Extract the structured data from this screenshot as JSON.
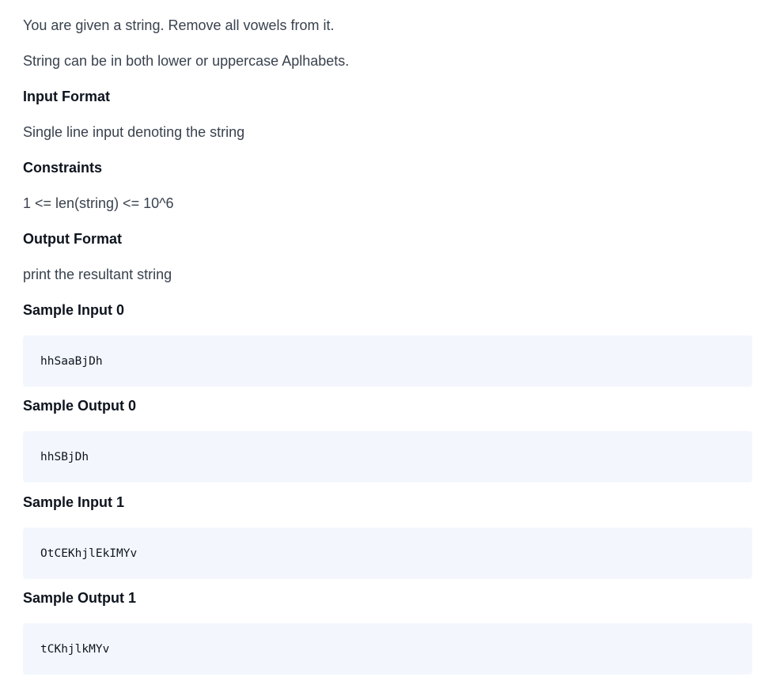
{
  "problem": {
    "statement_1": "You are given a string. Remove all vowels from it.",
    "statement_2": "String can be in both lower or uppercase Aplhabets.",
    "input_format_heading": "Input Format",
    "input_format_text": "Single line input denoting the string",
    "constraints_heading": "Constraints",
    "constraints_text": "1 <= len(string) <= 10^6",
    "output_format_heading": "Output Format",
    "output_format_text": "print the resultant string",
    "samples": [
      {
        "heading": "Sample Input 0",
        "code": "hhSaaBjDh"
      },
      {
        "heading": "Sample Output 0",
        "code": "hhSBjDh"
      },
      {
        "heading": "Sample Input 1",
        "code": "OtCEKhjlEkIMYv"
      },
      {
        "heading": "Sample Output 1",
        "code": "tCKhjlkMYv"
      }
    ]
  }
}
